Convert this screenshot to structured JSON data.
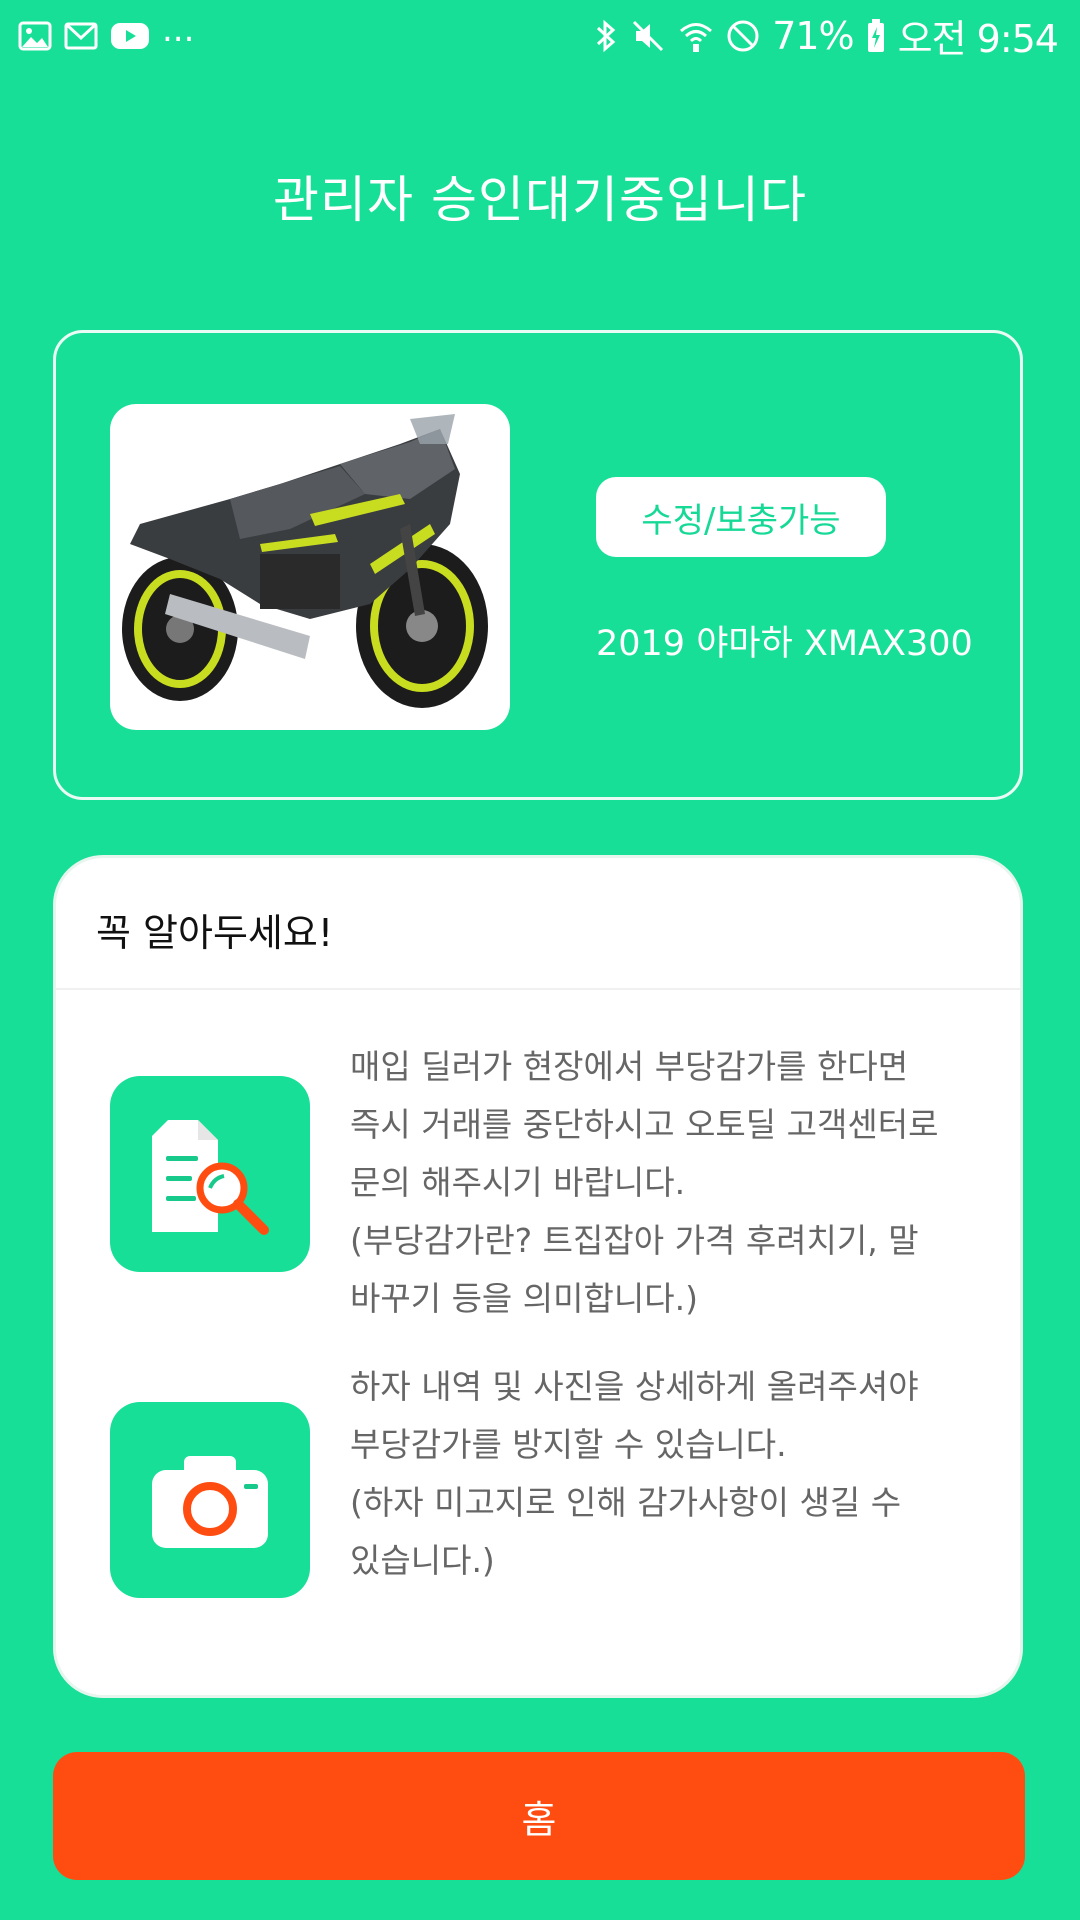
{
  "status_bar": {
    "overflow_indicator": "...",
    "battery_percent": "71%",
    "time": "오전 9:54",
    "left_icons": [
      "gallery-icon",
      "gmail-icon",
      "youtube-icon"
    ],
    "right_icons": [
      "bluetooth-icon",
      "mute-icon",
      "wifi-icon",
      "do-not-disturb-icon",
      "battery-charging-icon"
    ]
  },
  "header": {
    "title": "관리자 승인대기중입니다"
  },
  "vehicle": {
    "status_label": "수정/보충가능",
    "name": "2019 야마하 XMAX300"
  },
  "notice": {
    "title": "꼭 알아두세요!",
    "items": [
      {
        "icon": "document-search-icon",
        "text": "매입 딜러가 현장에서 부당감가를 한다면\n즉시 거래를 중단하시고 오토딜 고객센터로\n문의 해주시기 바랍니다.\n(부당감가란? 트집잡아 가격 후려치기, 말\n바꾸기 등을 의미합니다.)"
      },
      {
        "icon": "camera-icon",
        "text": "하자 내역 및 사진을 상세하게 올려주셔야\n부당감가를 방지할 수 있습니다.\n(하자 미고지로 인해 감가사항이 생길 수\n있습니다.)"
      }
    ]
  },
  "actions": {
    "home_label": "홈"
  },
  "colors": {
    "background": "#17df97",
    "home_button": "#ff4d12",
    "accent": "#17d996"
  }
}
